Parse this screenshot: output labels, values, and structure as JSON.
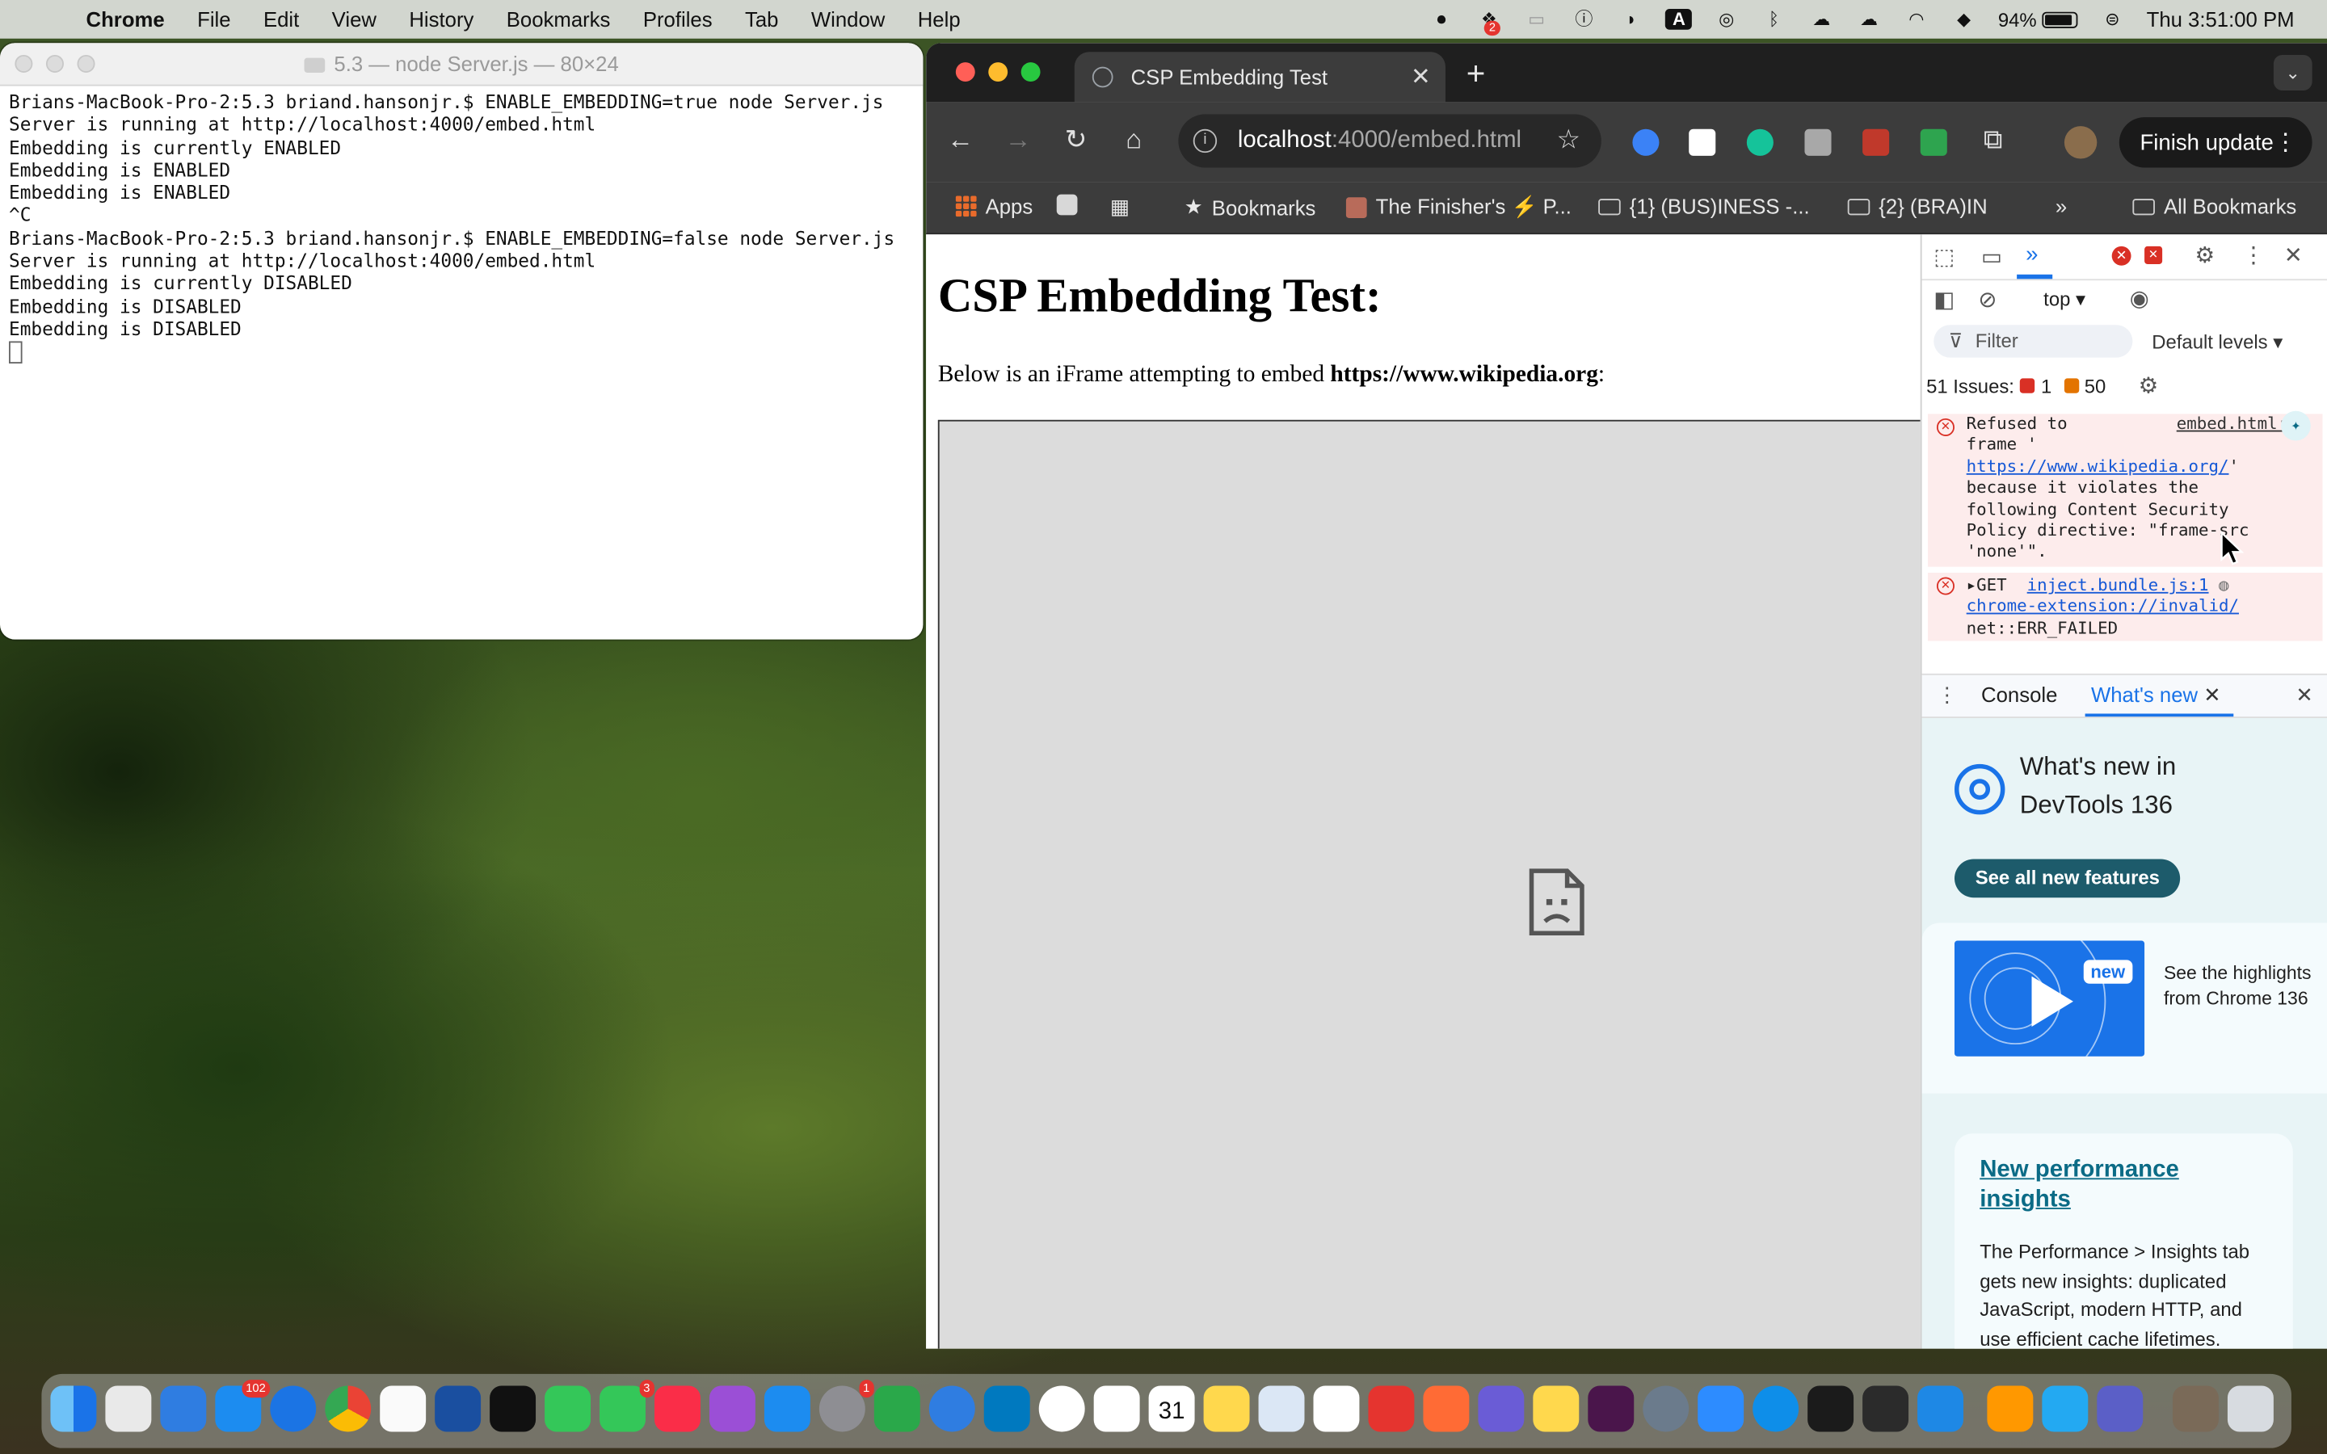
{
  "menubar": {
    "app": "Chrome",
    "items": [
      "File",
      "Edit",
      "View",
      "History",
      "Bookmarks",
      "Profiles",
      "Tab",
      "Window",
      "Help"
    ],
    "badge_count": "2",
    "battery": "94%",
    "clock": "Thu 3:51:00 PM"
  },
  "terminal": {
    "title": "5.3 — node Server.js — 80×24",
    "lines": [
      "Brians-MacBook-Pro-2:5.3 briand.hansonjr.$ ENABLE_EMBEDDING=true node Server.js",
      "Server is running at http://localhost:4000/embed.html",
      "Embedding is currently ENABLED",
      "Embedding is ENABLED",
      "Embedding is ENABLED",
      "^C",
      "Brians-MacBook-Pro-2:5.3 briand.hansonjr.$ ENABLE_EMBEDDING=false node Server.js",
      "Server is running at http://localhost:4000/embed.html",
      "Embedding is currently DISABLED",
      "Embedding is DISABLED",
      "Embedding is DISABLED"
    ]
  },
  "chrome": {
    "tab_title": "CSP Embedding Test",
    "url_host": "localhost",
    "url_path": ":4000/embed.html",
    "finish_update": "Finish update",
    "bookmarks": {
      "apps": "Apps",
      "bookmarks": "Bookmarks",
      "finisher": "The Finisher's ⚡ P...",
      "business": "{1} (BUS)INESS -...",
      "brain": "{2} (BRA)IN",
      "more": "»",
      "all": "All Bookmarks"
    }
  },
  "page": {
    "heading": "CSP Embedding Test:",
    "desc_prefix": "Below is an iFrame attempting to embed ",
    "desc_url": "https://www.wikipedia.org",
    "desc_suffix": ":"
  },
  "devtools": {
    "context": "top",
    "filter_placeholder": "Filter",
    "levels": "Default levels",
    "issues_label": "51 Issues:",
    "issues_errors": "1",
    "issues_warnings": "50",
    "error1": {
      "source": "embed.html:11",
      "line1": "Refused to",
      "line2": "frame '",
      "url": "https://www.wikipedia.org/",
      "line3": "'",
      "line4": "because it violates the",
      "line5": "following Content Security",
      "line6": "Policy directive: \"frame-src",
      "line7": "'none'\"."
    },
    "error2": {
      "method": "GET",
      "source": "inject.bundle.js:1",
      "url": "chrome-extension://invalid/",
      "status": "net::ERR_FAILED"
    },
    "drawer_console": "Console",
    "drawer_whatsnew": "What's new",
    "whats_new": {
      "title_line1": "What's new in",
      "title_line2": "DevTools 136",
      "see_all": "See all new features",
      "new_badge": "new",
      "highlights_line1": "See the highlights",
      "highlights_line2": "from Chrome 136",
      "card_title_line1": "New performance",
      "card_title_line2": "insights",
      "card_body": "The Performance > Insights tab gets new insights: duplicated JavaScript, modern HTTP, and use efficient cache lifetimes."
    }
  },
  "dock": {
    "appstore_badge": "102",
    "messages_badge": "3",
    "settings_badge": "1",
    "calendar_day": "31"
  }
}
